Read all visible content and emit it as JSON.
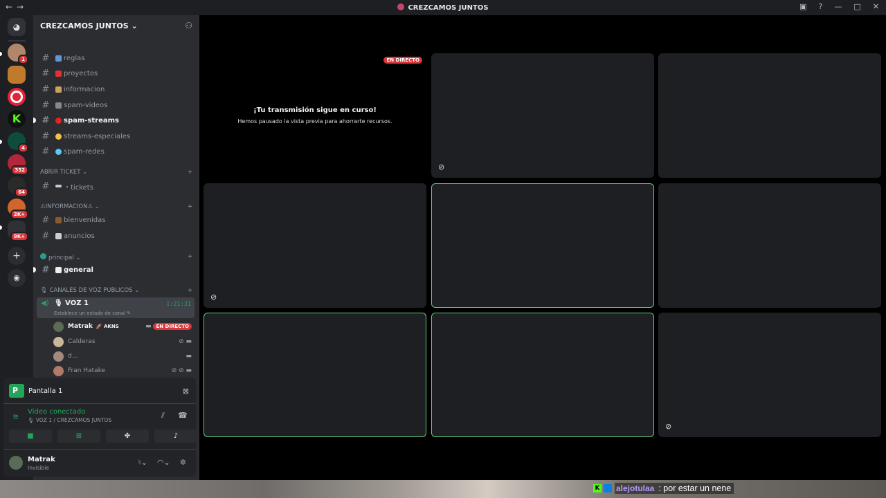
{
  "window": {
    "title": "CREZCAMOS JUNTOS"
  },
  "guilds": [
    {
      "name": "discord-home",
      "badge": ""
    },
    {
      "name": "server-1",
      "badge": "1"
    },
    {
      "name": "server-2",
      "badge": ""
    },
    {
      "name": "server-3",
      "badge": ""
    },
    {
      "name": "server-kick",
      "badge": ""
    },
    {
      "name": "server-5",
      "badge": "4"
    },
    {
      "name": "server-6",
      "badge": "352"
    },
    {
      "name": "server-7",
      "badge": "64"
    },
    {
      "name": "server-8",
      "badge": "2K+"
    },
    {
      "name": "folder",
      "badge": "9K+"
    }
  ],
  "server": {
    "name": "CREZCAMOS JUNTOS ⌄"
  },
  "channels": [
    {
      "label": "reglas",
      "emoji_color": "#5b9bd5"
    },
    {
      "label": "proyectos",
      "emoji_color": "#d33"
    },
    {
      "label": "informacion",
      "emoji_color": "#c9a35e"
    },
    {
      "label": "spam-videos",
      "emoji_color": "#888"
    },
    {
      "label": "spam-streams",
      "emoji_color": "#e02424"
    },
    {
      "label": "streams-especiales",
      "emoji_color": "#f4c04a"
    },
    {
      "label": "spam-redes",
      "emoji_color": "#5ac8fa"
    }
  ],
  "categories": {
    "ticket": "ABRIR TICKET ⌄",
    "ticket_channel": "・tickets",
    "info": "⚠INFORMACION⚠ ⌄",
    "info_channels": [
      "bienvenidas",
      "anuncios"
    ],
    "principal": "principal ⌄",
    "principal_channel": "general",
    "voice": "🎙 CANALES DE VOZ PUBLICOS ⌄"
  },
  "voice": {
    "name": "🎙 VOZ 1",
    "time": "1:21:31",
    "status": "Establece un estado de canal ✎",
    "users": [
      {
        "name": "Matrak",
        "tag": "🚀 AKNS",
        "live": "EN DIRECTO",
        "icons": "▬"
      },
      {
        "name": "Calderas",
        "tag": "",
        "live": "",
        "icons": "⊘ ▬"
      },
      {
        "name": "d...",
        "tag": "",
        "live": "",
        "icons": "▬"
      },
      {
        "name": "Fran Hatake",
        "tag": "",
        "live": "",
        "icons": "⊘ ⊘ ▬"
      }
    ]
  },
  "panel": {
    "screen": "Pantalla 1",
    "video_connected": "Video conectado",
    "video_sub": "🎙 VOZ 1 / CREZCAMOS JUNTOS",
    "user_name": "Matrak",
    "user_status": "Invisible"
  },
  "stream": {
    "live": "EN DIRECTO",
    "title": "¡Tu transmisión sigue en curso!",
    "subtitle": "Hemos pausado la vista previa para ahorrarte recursos."
  },
  "chat": {
    "user": "alejotulaa",
    "message": ": por estar un nene"
  },
  "colors": {
    "accent_green": "#23a55a",
    "live_red": "#da373c",
    "speaking_border": "#5fcf7c"
  }
}
